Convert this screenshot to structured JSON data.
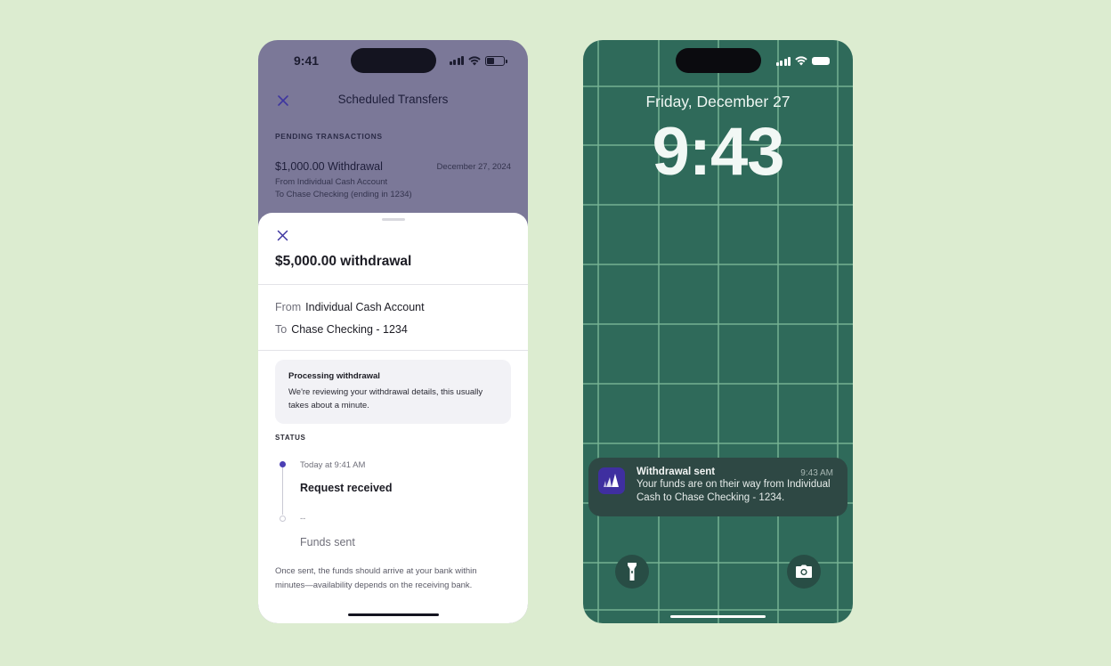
{
  "left_phone": {
    "status_time": "9:41",
    "header": {
      "title": "Scheduled Transfers"
    },
    "pending": {
      "section_label": "PENDING TRANSACTIONS",
      "item": {
        "amount": "$1,000.00 Withdrawal",
        "date": "December 27, 2024",
        "from": "From Individual Cash Account",
        "to": "To Chase Checking (ending in 1234)"
      }
    },
    "sheet": {
      "title": "$5,000.00 withdrawal",
      "from_label": "From",
      "from_value": "Individual Cash Account",
      "to_label": "To",
      "to_value": "Chase Checking - 1234",
      "info_title": "Processing withdrawal",
      "info_text": "We're reviewing your withdrawal details, this usually takes about a minute.",
      "status_label": "STATUS",
      "steps": [
        {
          "time": "Today at 9:41 AM",
          "title": "Request received"
        },
        {
          "time": "--",
          "title": "Funds sent"
        }
      ],
      "note": "Once sent, the funds should arrive at your bank within minutes—availability depends on the receiving bank."
    }
  },
  "right_phone": {
    "date": "Friday, December 27",
    "time": "9:43",
    "notification": {
      "app_icon": "wealthsimple-logo-icon",
      "title": "Withdrawal sent",
      "time": "9:43 AM",
      "body": "Your funds are on their way from Individual Cash to Chase Checking - 1234."
    },
    "buttons": [
      "flashlight-icon",
      "camera-icon"
    ]
  },
  "colors": {
    "background": "#dcecd0",
    "accent": "#4b3fb4",
    "lock_background": "#2f6a5a",
    "overlay": "#7b7898"
  }
}
